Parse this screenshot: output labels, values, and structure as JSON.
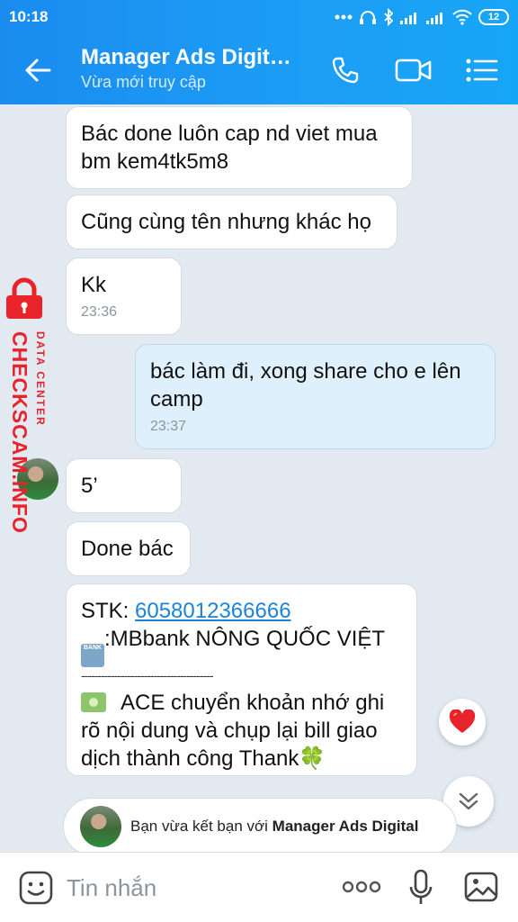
{
  "status_bar": {
    "time": "10:18",
    "battery": "12"
  },
  "header": {
    "title": "Manager Ads Digit…",
    "subtitle": "Vừa mới truy cập"
  },
  "messages": [
    {
      "lines": "Bác done luôn cap nd viet mua bm kem4tk5m8"
    },
    {
      "lines": "Cũng cùng tên nhưng khác họ"
    },
    {
      "lines": "Kk",
      "time": "23:36"
    },
    {
      "lines": "bác làm đi, xong share cho e lên camp",
      "time": "23:37"
    },
    {
      "lines": "5’"
    },
    {
      "lines": "Done bác"
    }
  ],
  "bank_message": {
    "stk_label": "STK: ",
    "account_number": "6058012366666",
    "bank_icon_text": "BANK",
    "bank_line": ":MBbank  NÔNG QUỐC VIỆT",
    "separator": "----------------------------------------",
    "note": "ACE chuyển khoản nhớ ghi rõ nội dung và chụp lại bill giao dịch thành công  Thank🍀"
  },
  "notice": {
    "prefix": "Bạn vừa kết bạn với ",
    "name": "Manager Ads Digital"
  },
  "input": {
    "placeholder": "Tin nhắn"
  },
  "watermark": {
    "brand": "CHECKSCAM.INFO",
    "sub": "DATA CENTER"
  },
  "colors": {
    "header_blue": "#1a8cf0",
    "outgoing_bubble": "#dff0fd",
    "link": "#1d83d8",
    "watermark_red": "#e8232a",
    "heart": "#e8232a"
  }
}
